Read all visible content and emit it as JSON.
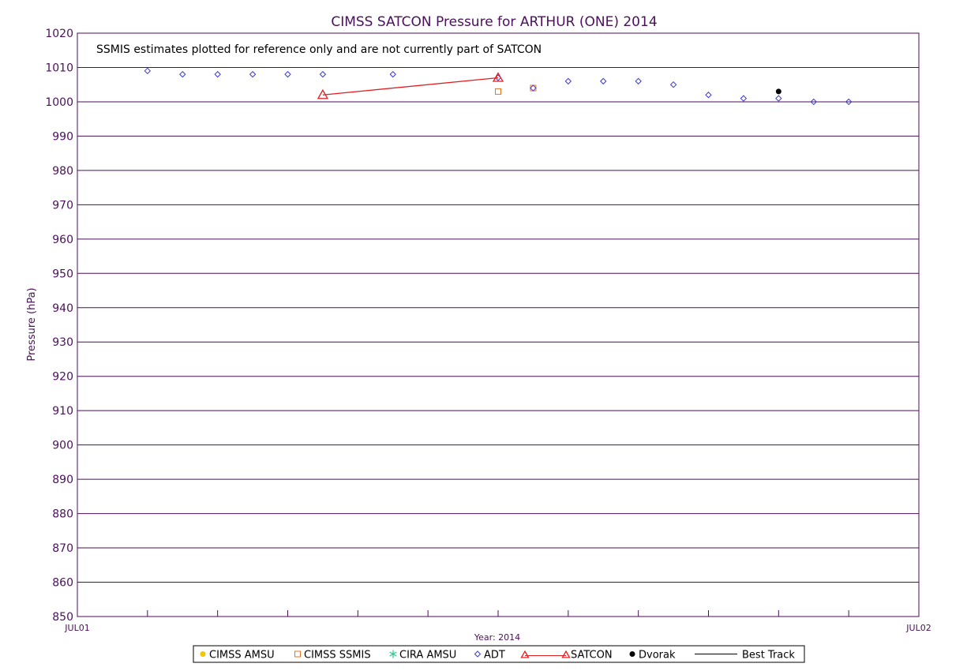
{
  "chart_data": {
    "type": "scatter",
    "title": "CIMSS SATCON Pressure for ARTHUR (ONE) 2014",
    "note": "SSMIS estimates plotted for reference only and are not currently part of SATCON",
    "ylabel": "Pressure (hPa)",
    "xlabel": "Year: 2014",
    "ylim": [
      850,
      1020
    ],
    "yticks": [
      850,
      860,
      870,
      880,
      890,
      900,
      910,
      920,
      930,
      940,
      950,
      960,
      970,
      980,
      990,
      1000,
      1010,
      1020
    ],
    "xlim_hours": [
      0,
      24
    ],
    "xtick_labels": [
      {
        "hour": 0,
        "label": "JUL01"
      },
      {
        "hour": 24,
        "label": "JUL02"
      }
    ],
    "x_gridlines_hours": [
      2,
      4,
      6,
      8,
      10,
      12,
      14,
      16,
      18,
      20,
      22
    ],
    "grid": true,
    "legend_position": "bottom",
    "series": [
      {
        "name": "CIMSS AMSU",
        "marker": "filled-circle",
        "color": "#f5c400",
        "points": []
      },
      {
        "name": "CIMSS SSMIS",
        "marker": "square",
        "color": "#e8731e",
        "points": [
          {
            "x": 12.0,
            "y": 1003
          },
          {
            "x": 13.0,
            "y": 1004
          }
        ]
      },
      {
        "name": "CIRA AMSU",
        "marker": "asterisk",
        "color": "#22cc88",
        "points": []
      },
      {
        "name": "ADT",
        "marker": "diamond",
        "color": "#3a3ad6",
        "points": [
          {
            "x": 2.0,
            "y": 1009
          },
          {
            "x": 3.0,
            "y": 1008
          },
          {
            "x": 4.0,
            "y": 1008
          },
          {
            "x": 5.0,
            "y": 1008
          },
          {
            "x": 6.0,
            "y": 1008
          },
          {
            "x": 7.0,
            "y": 1008
          },
          {
            "x": 9.0,
            "y": 1008
          },
          {
            "x": 12.0,
            "y": 1007
          },
          {
            "x": 13.0,
            "y": 1004
          },
          {
            "x": 14.0,
            "y": 1006
          },
          {
            "x": 15.0,
            "y": 1006
          },
          {
            "x": 16.0,
            "y": 1006
          },
          {
            "x": 17.0,
            "y": 1005
          },
          {
            "x": 18.0,
            "y": 1002
          },
          {
            "x": 19.0,
            "y": 1001
          },
          {
            "x": 20.0,
            "y": 1001
          },
          {
            "x": 21.0,
            "y": 1000
          },
          {
            "x": 22.0,
            "y": 1000
          }
        ]
      },
      {
        "name": "SATCON",
        "marker": "triangle-line",
        "color": "#e02020",
        "points": [
          {
            "x": 7.0,
            "y": 1002
          },
          {
            "x": 12.0,
            "y": 1007
          }
        ]
      },
      {
        "name": "Dvorak",
        "marker": "filled-circle",
        "color": "#000000",
        "points": [
          {
            "x": 20.0,
            "y": 1003
          }
        ]
      },
      {
        "name": "Best Track",
        "marker": "line",
        "color": "#000000",
        "points": []
      }
    ]
  }
}
